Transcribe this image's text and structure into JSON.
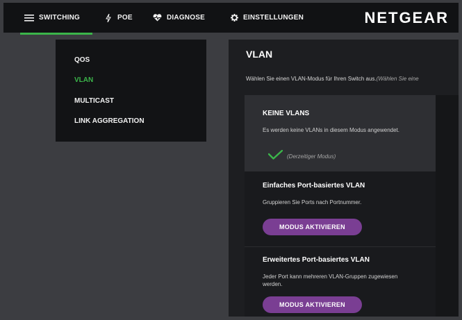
{
  "nav": {
    "items": [
      {
        "label": "SWITCHING",
        "icon": "menu-icon"
      },
      {
        "label": "POE",
        "icon": "bolt-icon"
      },
      {
        "label": "DIAGNOSE",
        "icon": "heartbeat-icon"
      },
      {
        "label": "EINSTELLUNGEN",
        "icon": "gear-icon"
      }
    ],
    "brand": "NETGEAR",
    "active_color": "#3bb54a"
  },
  "submenu": {
    "items": [
      {
        "label": "QOS"
      },
      {
        "label": "VLAN",
        "active": true
      },
      {
        "label": "MULTICAST"
      },
      {
        "label": "LINK AGGREGATION"
      }
    ]
  },
  "panel": {
    "title": "VLAN",
    "description": "Wählen Sie einen VLAN-Modus für Ihren Switch aus.",
    "description_hint": "(Wählen Sie eine",
    "cards": [
      {
        "title": "KEINE VLANS",
        "text": "Es werden keine VLANs in diesem Modus angewendet.",
        "status": "(Derzeitiger Modus)"
      },
      {
        "title": "Einfaches Port-basiertes VLAN",
        "text": "Gruppieren Sie Ports nach Portnummer.",
        "button": "MODUS AKTIVIEREN"
      },
      {
        "title": "Erweitertes Port-basiertes VLAN",
        "text": "Jeder Port kann mehreren VLAN-Gruppen zugewiesen werden.",
        "button": "MODUS AKTIVIEREN"
      }
    ],
    "button_color": "#7a3e93"
  }
}
